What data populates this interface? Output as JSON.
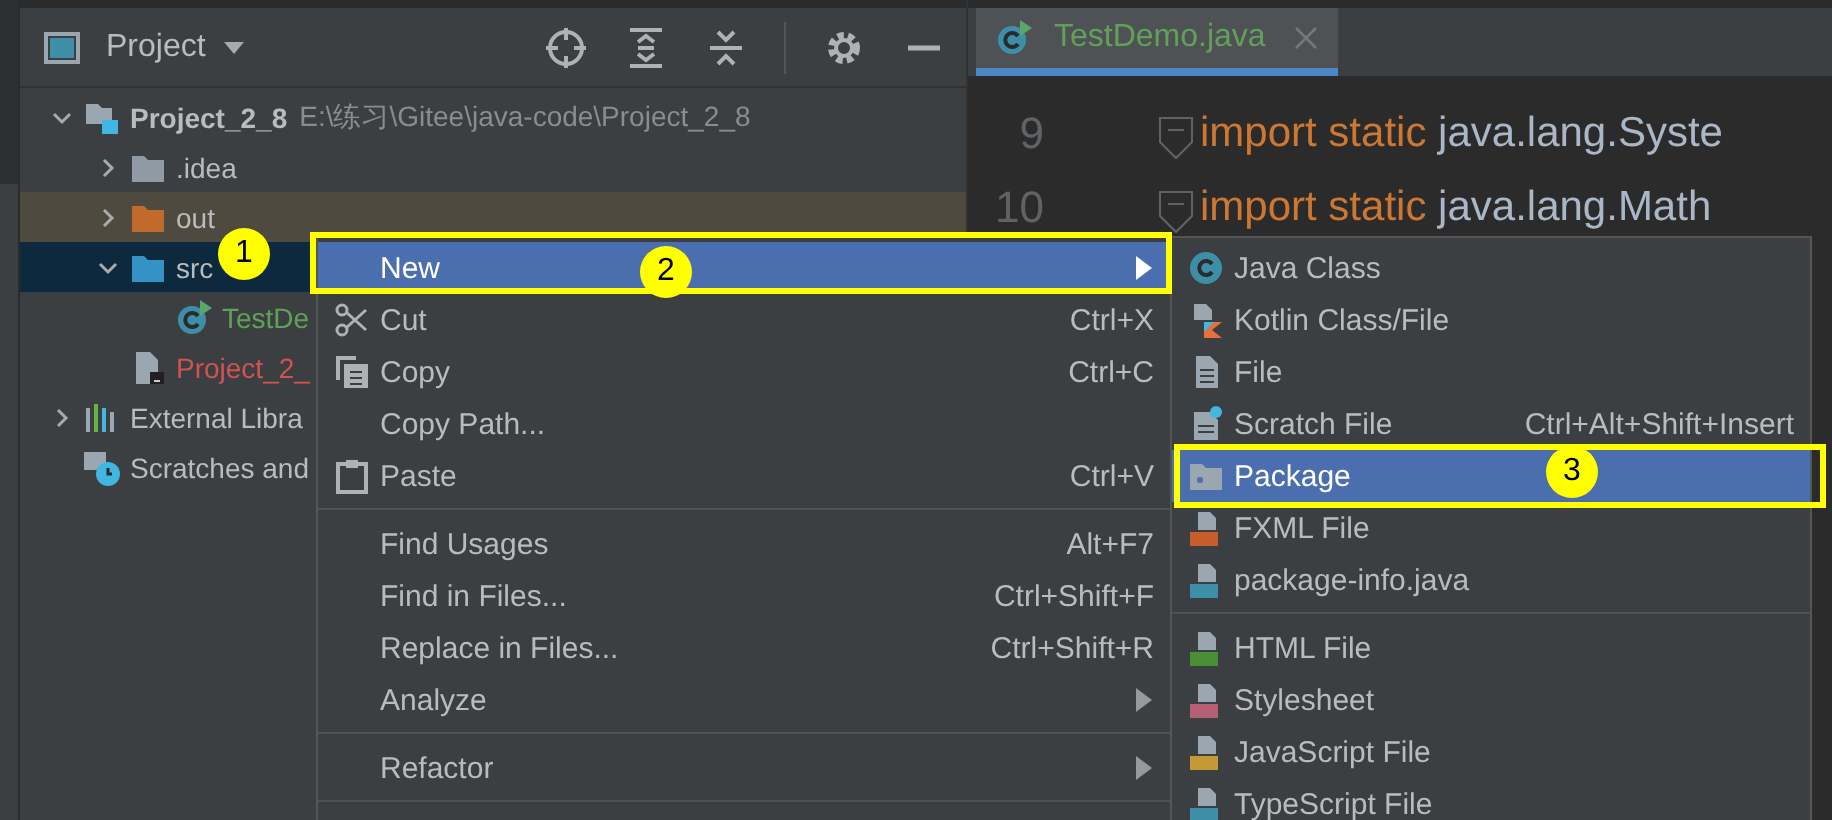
{
  "project_panel": {
    "title": "Project",
    "tree": [
      {
        "kind": "module",
        "name": "Project_2_8",
        "path": "E:\\练习\\Gitee\\java-code\\Project_2_8",
        "expanded": true,
        "selected": false,
        "highlighted": false,
        "children": [
          {
            "kind": "folder",
            "name": ".idea",
            "expanded": false,
            "selected": false,
            "highlighted": false
          },
          {
            "kind": "excluded-folder",
            "name": "out",
            "expanded": false,
            "selected": false,
            "highlighted": true
          },
          {
            "kind": "source-folder",
            "name": "src",
            "expanded": true,
            "selected": true,
            "highlighted": false,
            "children": [
              {
                "kind": "java-class",
                "name": "TestDe",
                "selected": false,
                "highlighted": false
              }
            ]
          },
          {
            "kind": "module-file",
            "name": "Project_2_",
            "selected": false,
            "highlighted": false
          }
        ]
      },
      {
        "kind": "libraries",
        "name": "External Libra",
        "expanded": false,
        "selected": false,
        "highlighted": false
      },
      {
        "kind": "scratches",
        "name": "Scratches and",
        "selected": false,
        "highlighted": false
      }
    ]
  },
  "editor": {
    "tabs": [
      {
        "label": "TestDemo.java",
        "selected": true
      }
    ],
    "lines": [
      {
        "number": "9",
        "keyword": "import static",
        "text": "java.lang.Syste"
      },
      {
        "number": "10",
        "keyword": "import static",
        "text": "java.lang.Math"
      }
    ]
  },
  "context_menu": {
    "items": [
      {
        "kind": "item",
        "label": "New",
        "selected": true,
        "submenu": true
      },
      {
        "kind": "item",
        "label": "Cut",
        "shortcut": "Ctrl+X",
        "selected": false,
        "submenu": false
      },
      {
        "kind": "item",
        "label": "Copy",
        "shortcut": "Ctrl+C",
        "selected": false,
        "submenu": false
      },
      {
        "kind": "item",
        "label": "Copy Path...",
        "selected": false,
        "submenu": false
      },
      {
        "kind": "item",
        "label": "Paste",
        "shortcut": "Ctrl+V",
        "selected": false,
        "submenu": false
      },
      {
        "kind": "separator"
      },
      {
        "kind": "item",
        "label": "Find Usages",
        "shortcut": "Alt+F7",
        "selected": false,
        "submenu": false
      },
      {
        "kind": "item",
        "label": "Find in Files...",
        "shortcut": "Ctrl+Shift+F",
        "selected": false,
        "submenu": false
      },
      {
        "kind": "item",
        "label": "Replace in Files...",
        "shortcut": "Ctrl+Shift+R",
        "selected": false,
        "submenu": false
      },
      {
        "kind": "item",
        "label": "Analyze",
        "selected": false,
        "submenu": true
      },
      {
        "kind": "separator"
      },
      {
        "kind": "item",
        "label": "Refactor",
        "selected": false,
        "submenu": true
      },
      {
        "kind": "separator"
      }
    ]
  },
  "submenu": {
    "items": [
      {
        "kind": "item",
        "label": "Java Class",
        "selected": false
      },
      {
        "kind": "item",
        "label": "Kotlin Class/File",
        "selected": false
      },
      {
        "kind": "item",
        "label": "File",
        "selected": false
      },
      {
        "kind": "item",
        "label": "Scratch File",
        "shortcut": "Ctrl+Alt+Shift+Insert",
        "selected": false
      },
      {
        "kind": "item",
        "label": "Package",
        "selected": true
      },
      {
        "kind": "item",
        "label": "FXML File",
        "selected": false
      },
      {
        "kind": "item",
        "label": "package-info.java",
        "selected": false
      },
      {
        "kind": "separator"
      },
      {
        "kind": "item",
        "label": "HTML File",
        "selected": false
      },
      {
        "kind": "item",
        "label": "Stylesheet",
        "selected": false
      },
      {
        "kind": "item",
        "label": "JavaScript File",
        "selected": false
      },
      {
        "kind": "item",
        "label": "TypeScript File",
        "selected": false
      }
    ]
  },
  "annotations": [
    {
      "label": "1"
    },
    {
      "label": "2"
    },
    {
      "label": "3"
    }
  ]
}
